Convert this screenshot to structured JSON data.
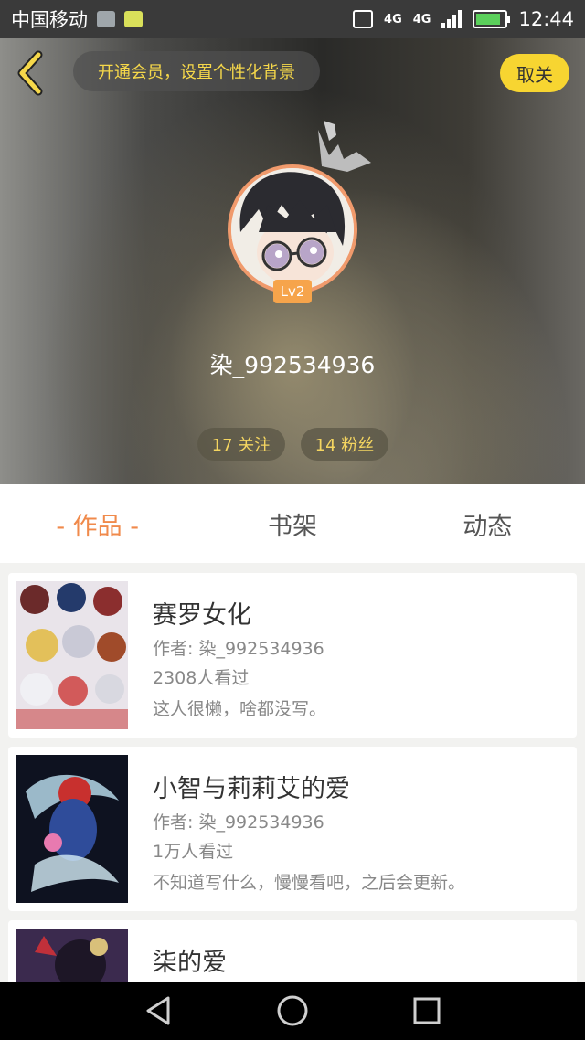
{
  "status_bar": {
    "carrier": "中国移动",
    "network_1": "4G",
    "network_2": "4G",
    "time": "12:44",
    "icons": [
      "gallery-icon",
      "chat-icon",
      "vibrate-icon",
      "signal-icon",
      "battery-icon"
    ]
  },
  "header": {
    "vip_banner": "开通会员，设置个性化背景",
    "unfollow_label": "取关",
    "level": "Lv2",
    "username": "染_992534936",
    "following": "17 关注",
    "fans": "14 粉丝",
    "accent_color": "#f7d531"
  },
  "tabs": [
    {
      "label": "- 作品 -",
      "active": true
    },
    {
      "label": "书架",
      "active": false
    },
    {
      "label": "动态",
      "active": false
    }
  ],
  "works": [
    {
      "title": "赛罗女化",
      "author": "作者: 染_992534936",
      "views": "2308人看过",
      "desc": "这人很懒，啥都没写。"
    },
    {
      "title": "小智与莉莉艾的爱",
      "author": "作者: 染_992534936",
      "views": "1万人看过",
      "desc": "不知道写什么，慢慢看吧，之后会更新。"
    },
    {
      "title": "柒的爱",
      "author": "",
      "views": "",
      "desc": ""
    }
  ],
  "nav": {
    "icons": [
      "back-triangle-icon",
      "home-circle-icon",
      "recents-square-icon"
    ]
  }
}
